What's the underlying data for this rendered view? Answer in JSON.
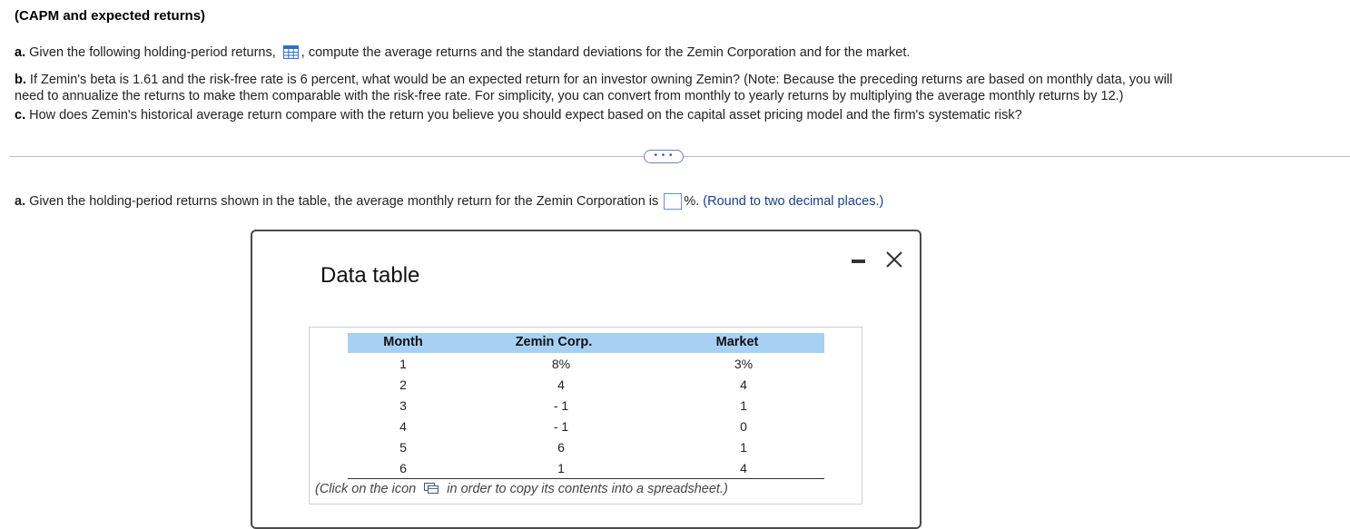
{
  "problem": {
    "title": "(CAPM and expected returns)",
    "part_a": {
      "label": "a.",
      "text_before": "Given the following holding-period returns,",
      "text_after": ", compute the average returns and the standard deviations for the Zemin Corporation and for the market."
    },
    "part_b": {
      "label": "b.",
      "line1": "If Zemin's beta is 1.61 and the risk-free rate is 6 percent, what would be an expected return for an investor owning Zemin?  (Note: Because the preceding returns are based on monthly data, you will",
      "line2": "need to annualize the returns to make them comparable with the risk-free rate.  For simplicity, you can convert from monthly to yearly returns by multiplying the average monthly returns by 12.)"
    },
    "part_c": {
      "label": "c.",
      "text": "How does Zemin's historical average return compare with the return you believe you should expect based on the capital asset pricing model and the firm's systematic risk?"
    }
  },
  "more_button_label": "• • •",
  "answer": {
    "label": "a.",
    "text_before": "Given the holding-period returns shown in the table, the average monthly return for the Zemin Corporation is",
    "input_value": "",
    "text_after": "%.",
    "hint": "(Round to two decimal places.)"
  },
  "dialog": {
    "title": "Data table",
    "table": {
      "headers": [
        "Month",
        "Zemin Corp.",
        "Market"
      ],
      "rows": [
        [
          "1",
          "8%",
          "3%"
        ],
        [
          "2",
          "4",
          "4"
        ],
        [
          "3",
          "- 1",
          "1"
        ],
        [
          "4",
          "- 1",
          "0"
        ],
        [
          "5",
          "6",
          "1"
        ],
        [
          "6",
          "1",
          "4"
        ]
      ]
    },
    "footnote_before": "(Click on the icon",
    "footnote_after": "in order to copy its contents into a spreadsheet.)"
  },
  "colors": {
    "header_bg": "#a7d0f4",
    "hint_text": "#1a3e8c",
    "icon_blue": "#2f6fc8"
  }
}
